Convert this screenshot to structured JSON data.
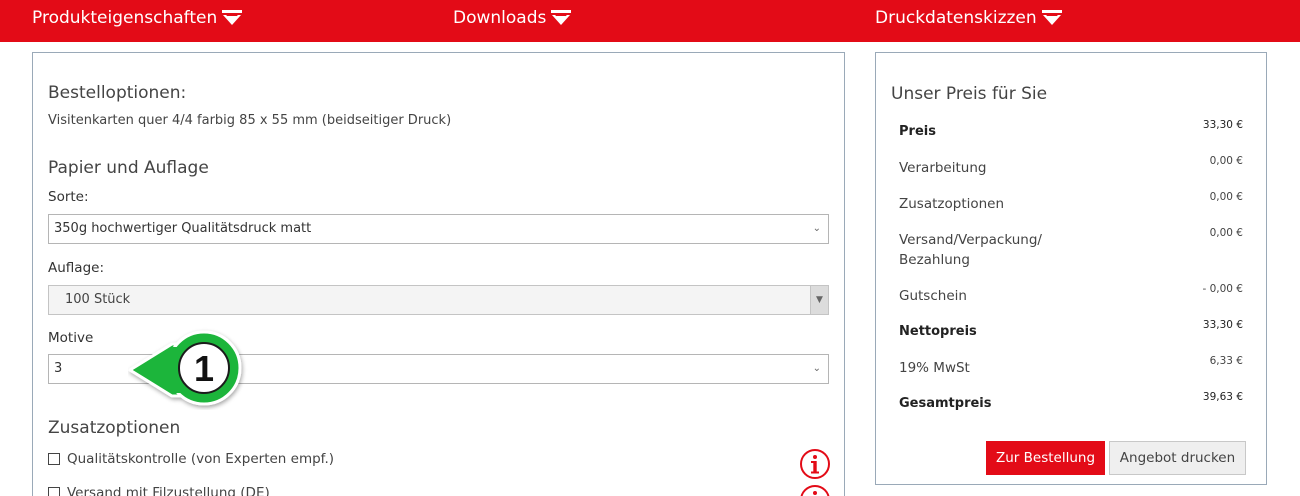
{
  "nav": {
    "items": [
      {
        "label": "Produkteigenschaften"
      },
      {
        "label": "Downloads"
      },
      {
        "label": "Druckdatenskizzen"
      }
    ]
  },
  "order_options": {
    "heading": "Bestelloptionen:",
    "description": "Visitenkarten quer 4/4 farbig 85 x 55 mm (beidseitiger Druck)",
    "paper_heading": "Papier und Auflage",
    "sorte_label": "Sorte:",
    "sorte_value": "350g hochwertiger Qualitätsdruck matt",
    "auflage_label": "Auflage:",
    "auflage_value": "100 Stück",
    "motive_label": "Motive",
    "motive_value": "3",
    "zusatz_heading": "Zusatzoptionen",
    "zusatz_options": [
      {
        "label": "Qualitätskontrolle (von Experten empf.)",
        "checked": false
      },
      {
        "label": "Versand mit Filzustellung (DE)",
        "checked": false
      }
    ]
  },
  "callout": {
    "number": "1",
    "color": "#1db53a"
  },
  "price_box": {
    "title": "Unser Preis für Sie",
    "rows": [
      {
        "label": "Preis",
        "value": "33,30 €"
      },
      {
        "label": "Verarbeitung",
        "value": "0,00 €"
      },
      {
        "label": "Zusatzoptionen",
        "value": "0,00 €"
      },
      {
        "label": "Versand/Verpackung/ Bezahlung",
        "value": "0,00 €"
      },
      {
        "label": "Gutschein",
        "value": "- 0,00 €"
      },
      {
        "label": "Nettopreis",
        "value": "33,30 €"
      },
      {
        "label": "19% MwSt",
        "value": "6,33 €"
      },
      {
        "label": "Gesamtpreis",
        "value": "39,63 €"
      }
    ],
    "order_button": "Zur Bestellung",
    "print_button": "Angebot drucken"
  },
  "colors": {
    "brand_red": "#e30b17",
    "callout_green": "#1db53a",
    "border": "#9aa9b8"
  }
}
